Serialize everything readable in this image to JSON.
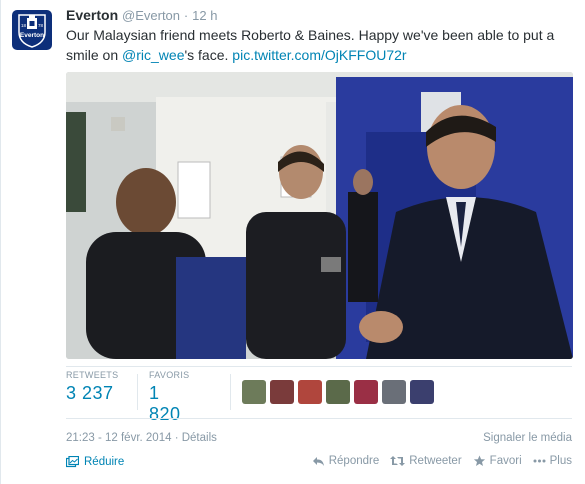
{
  "tweet": {
    "author_name": "Everton",
    "author_handle": "@Everton",
    "separator": "·",
    "time_ago": "12 h",
    "text_main": "Our Malaysian friend meets Roberto & Baines. Happy we've been able to put a smile on ",
    "mention": "@ric_wee",
    "text_after_mention": "'s face. ",
    "link": "pic.twitter.com/OjKFFOU72r",
    "avatar_text": "Everton",
    "avatar_year_left": "18",
    "avatar_year_right": "78"
  },
  "stats": {
    "retweets_label": "RETWEETS",
    "retweets_value": "3 237",
    "favorites_label": "FAVORIS",
    "favorites_value": "1 820"
  },
  "favoriters": [
    {
      "name": "user-avatar-1",
      "color": "#6d7b5a"
    },
    {
      "name": "user-avatar-2",
      "color": "#7a3b3b"
    },
    {
      "name": "user-avatar-3",
      "color": "#b0463d"
    },
    {
      "name": "user-avatar-4",
      "color": "#5b6a4a"
    },
    {
      "name": "user-avatar-5",
      "color": "#9a2f45"
    },
    {
      "name": "user-avatar-6",
      "color": "#6a6f78"
    },
    {
      "name": "user-avatar-7",
      "color": "#3b3f6e"
    }
  ],
  "meta": {
    "timestamp": "21:23 - 12 févr. 2014",
    "separator": " · ",
    "details": "Détails",
    "report": "Signaler le média"
  },
  "actions": {
    "collapse": "Réduire",
    "reply": "Répondre",
    "retweet": "Retweeter",
    "favorite": "Favori",
    "more": "Plus"
  },
  "colors": {
    "link": "#0084b4",
    "muted": "#8899a6",
    "everton_blue": "#0d2f7a"
  }
}
